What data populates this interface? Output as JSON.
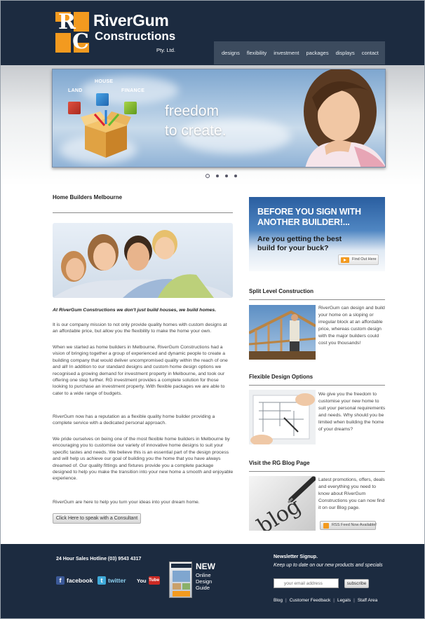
{
  "brand": {
    "letters": [
      "R",
      "C"
    ],
    "name": "RiverGum",
    "name2": "Constructions",
    "suffix": "Pty. Ltd.",
    "accent": "#f39a1f",
    "header_bg": "#1c2b40"
  },
  "nav": [
    "designs",
    "flexibility",
    "investment",
    "packages",
    "displays",
    "contact"
  ],
  "hero": {
    "words": [
      "LAND",
      "HOUSE",
      "FINANCE"
    ],
    "slogan_line1": "freedom",
    "slogan_line2": "to create.",
    "slides": 4,
    "active_slide": 1
  },
  "main": {
    "title": "Home Builders Melbourne",
    "tagline": "At RiverGum Constructions we don't just build houses, we build homes.",
    "paragraphs": [
      "It is our company mission to not only provide quality homes with custom designs at an affordable price, but allow you the flexibility to make the home your own.",
      "When we started as home builders in Melbourne, RiverGum Constructions had a vision of bringing together a group of experienced and dynamic people to create a building company that would deliver uncompromised quality within the reach of one and all! In addition to our standard designs and custom home design options we recognised a growing demand for investment property in Melbourne, and took our offering one step further. RG investment provides a complete solution for those looking to purchase an investment property. With flexible packages we are able to cater to a wide range of budgets.",
      "RiverGum now has a reputation as a flexible quality home builder providing a complete service with a dedicated personal approach.",
      "We pride ourselves on being one of the most flexible home builders in Melbourne by encouraging you to customise our variety of innovative home designs to suit your specific tastes and needs. We believe this is an essential part of the design process and will help us achieve our goal of building you the home that you have always dreamed of. Our quality fittings and fixtures provide you a complete package designed to help you make the transition into your new home a smooth and enjoyable experience.",
      "RiverGum are here to help you turn your ideas into your dream home."
    ],
    "consult_button": "Click Here to speak with a Consultant"
  },
  "promo": {
    "line1": "BEFORE YOU SIGN WITH",
    "line2": "ANOTHER BUILDER!...",
    "q1": "Are you getting the best",
    "q2": "build for your buck?",
    "button": "Find Out Here"
  },
  "sidebar": [
    {
      "title": "Split Level Construction",
      "text": "RiverGum can design and build your home on a sloping or irregular block at an affordable price, whereas custom design with the major builders could cost you thousands!"
    },
    {
      "title": "Flexible Design Options",
      "text": "We give you the freedom to customise your new home to suit your personal requirements and needs. Why should you be limited when building the home of your dreams?"
    },
    {
      "title": "Visit the RG Blog Page",
      "text": "Latest promotions, offers, deals and everything you need to know about RiverGum Constructions you can now find it on our Blog page.",
      "image_word": "blog",
      "button": "RSS Feed Now Available!"
    }
  ],
  "footer": {
    "hotline": "24 Hour Sales Hotline (03) 9543 4317",
    "social": [
      {
        "icon": "f",
        "label": "facebook",
        "color": "#3b5998"
      },
      {
        "icon": "t",
        "label": "twitter",
        "color": "#3fa9d8"
      },
      {
        "icon": "You",
        "label": "Tube",
        "color": "#cc2a24"
      }
    ],
    "guide_new": "NEW",
    "guide_lines": [
      "Online",
      "Design",
      "Guide"
    ],
    "newsletter_title": "Newsletter Signup.",
    "newsletter_sub": "Keep up to date on our new products and specials",
    "email_placeholder": "your email address",
    "subscribe": "subscribe",
    "links": [
      "Blog",
      "Customer Feedback",
      "Legals",
      "Staff Area"
    ]
  }
}
